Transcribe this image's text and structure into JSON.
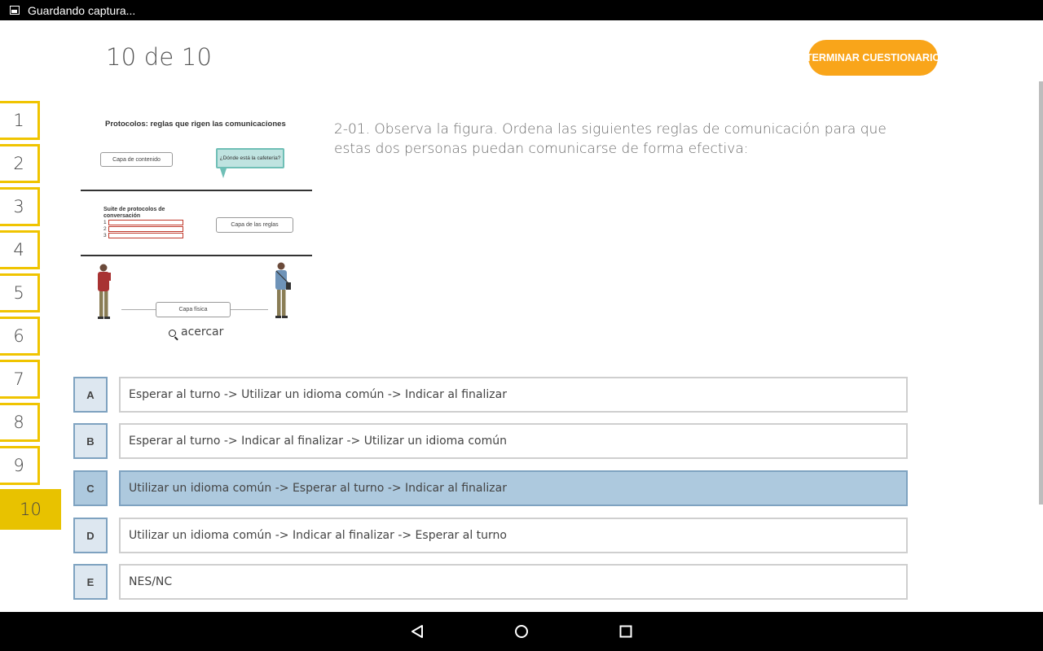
{
  "status_bar": {
    "text": "Guardando captura...",
    "icon": "image-icon"
  },
  "header": {
    "counter": "10 de 10",
    "finish_button": "TERMINAR CUESTIONARIO",
    "accent_color": "#f9a51a"
  },
  "sidebar": {
    "items": [
      {
        "label": "1"
      },
      {
        "label": "2"
      },
      {
        "label": "3"
      },
      {
        "label": "4"
      },
      {
        "label": "5"
      },
      {
        "label": "6"
      },
      {
        "label": "7"
      },
      {
        "label": "8"
      },
      {
        "label": "9"
      },
      {
        "label": "10"
      }
    ],
    "active": "10",
    "border_color": "#f0c400",
    "active_color": "#e8c200"
  },
  "figure": {
    "title": "Protocolos: reglas que rigen las comunicaciones",
    "content_layer": "Capa de contenido",
    "speech_bubble": "¿Dónde está la cafetería?",
    "suite_title": "Suite de protocolos de conversación",
    "suite_items": [
      "1",
      "2",
      "3"
    ],
    "rules_layer": "Capa de las reglas",
    "physical_layer": "Capa física",
    "zoom_label": "acercar"
  },
  "question": {
    "text": "2-01. Observa la figura. Ordena las siguientes reglas de comunicación para que estas dos personas puedan comunicarse de forma efectiva:"
  },
  "options": [
    {
      "letter": "A",
      "text": "Esperar al turno -> Utilizar un idioma común -> Indicar al finalizar",
      "selected": false
    },
    {
      "letter": "B",
      "text": "Esperar al turno -> Indicar al finalizar -> Utilizar un idioma común",
      "selected": false
    },
    {
      "letter": "C",
      "text": "Utilizar un idioma común -> Esperar al turno -> Indicar al finalizar",
      "selected": true
    },
    {
      "letter": "D",
      "text": "Utilizar un idioma común -> Indicar al finalizar -> Esperar al turno",
      "selected": false
    },
    {
      "letter": "E",
      "text": "NES/NC",
      "selected": false
    }
  ],
  "system_nav": {
    "buttons": [
      "back-icon",
      "home-icon",
      "recents-icon"
    ]
  }
}
